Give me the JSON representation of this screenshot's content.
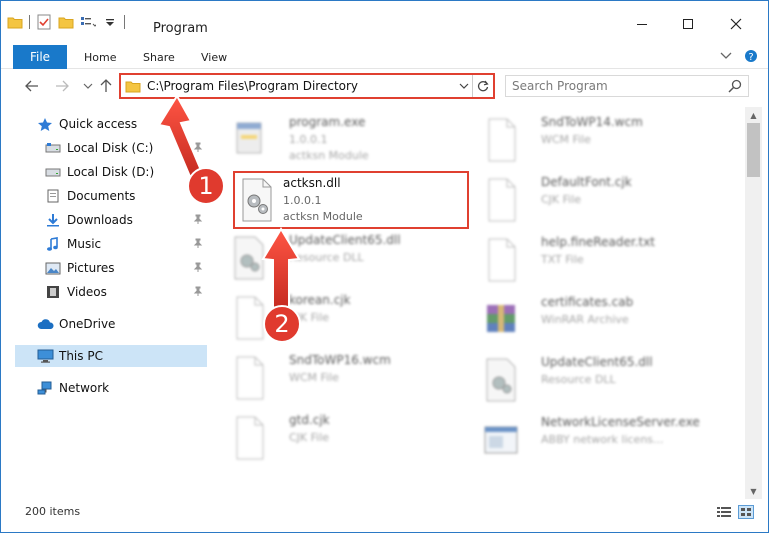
{
  "window": {
    "title": "Program",
    "colors": {
      "accent": "#1979ca",
      "highlight_border": "#e04030",
      "callout": "#e03a2e",
      "selected": "#cce4f7"
    }
  },
  "quick_access_toolbar": [
    "folder-icon",
    "properties-check-icon",
    "new-folder-icon",
    "customize-menu-icon"
  ],
  "ribbon": {
    "file": "File",
    "home": "Home",
    "share": "Share",
    "view": "View"
  },
  "address": {
    "path": "C:\\Program Files\\Program Directory",
    "search_placeholder": "Search Program"
  },
  "sidebar": {
    "items": [
      {
        "label": "Quick access",
        "icon": "star-icon",
        "level": 0
      },
      {
        "label": "Local Disk (C:)",
        "icon": "drive-icon",
        "level": 1,
        "pinned": true
      },
      {
        "label": "Local Disk (D:)",
        "icon": "drive-icon",
        "level": 1
      },
      {
        "label": "Documents",
        "icon": "documents-icon",
        "level": 1,
        "pinned": true
      },
      {
        "label": "Downloads",
        "icon": "download-icon",
        "level": 1,
        "pinned": true
      },
      {
        "label": "Music",
        "icon": "music-icon",
        "level": 1,
        "pinned": true
      },
      {
        "label": "Pictures",
        "icon": "pictures-icon",
        "level": 1,
        "pinned": true
      },
      {
        "label": "Videos",
        "icon": "videos-icon",
        "level": 1,
        "pinned": true
      },
      {
        "label": "OneDrive",
        "icon": "cloud-icon",
        "level": 0
      },
      {
        "label": "This PC",
        "icon": "computer-icon",
        "level": 0,
        "selected": true
      },
      {
        "label": "Network",
        "icon": "network-icon",
        "level": 0
      }
    ]
  },
  "files": {
    "left": [
      {
        "name": "program.exe",
        "line2": "1.0.0.1",
        "line3": "actksn Module",
        "icon": "exe-icon"
      },
      {
        "name": "actksn.dll",
        "line2": "1.0.0.1",
        "line3": "actksn Module",
        "icon": "dll-gear-icon",
        "highlighted": true
      },
      {
        "name": "UpdateClient65.dll",
        "line2": "Resource DLL",
        "line3": "",
        "icon": "dll-gear-icon"
      },
      {
        "name": "korean.cjk",
        "line2": "CJK File",
        "line3": "",
        "icon": "blank-file-icon"
      },
      {
        "name": "SndToWP16.wcm",
        "line2": "WCM File",
        "line3": "",
        "icon": "blank-file-icon"
      },
      {
        "name": "gtd.cjk",
        "line2": "CJK File",
        "line3": "",
        "icon": "blank-file-icon"
      }
    ],
    "right": [
      {
        "name": "SndToWP14.wcm",
        "line2": "WCM File",
        "line3": "",
        "icon": "blank-file-icon"
      },
      {
        "name": "DefaultFont.cjk",
        "line2": "CJK File",
        "line3": "",
        "icon": "blank-file-icon"
      },
      {
        "name": "help.fineReader.txt",
        "line2": "TXT File",
        "line3": "",
        "icon": "blank-file-icon"
      },
      {
        "name": "certificates.cab",
        "line2": "WinRAR Archive",
        "line3": "",
        "icon": "winrar-icon"
      },
      {
        "name": "UpdateClient65.dll",
        "line2": "Resource DLL",
        "line3": "",
        "icon": "dll-gear-icon"
      },
      {
        "name": "NetworkLicenseServer.exe",
        "line2": "ABBY network licens...",
        "line3": "",
        "icon": "app-window-icon"
      }
    ]
  },
  "status": {
    "items": "200 items"
  },
  "callouts": {
    "one": "1",
    "two": "2"
  }
}
